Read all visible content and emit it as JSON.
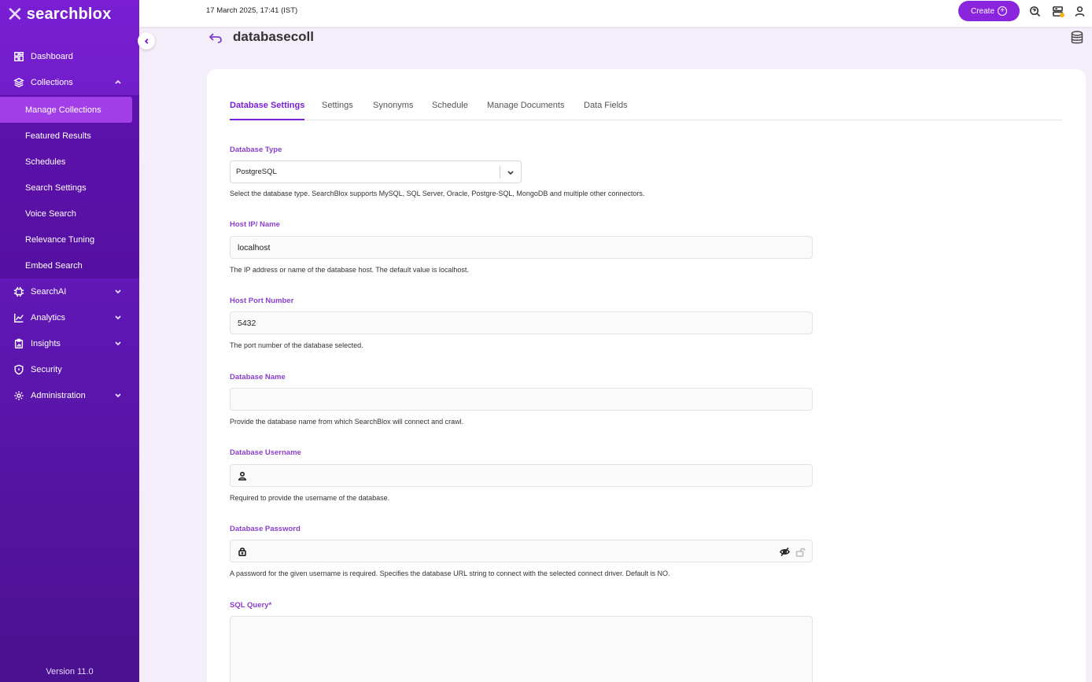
{
  "brand": {
    "mark": "✕",
    "name": "searchblox"
  },
  "sidebar": {
    "items": [
      {
        "label": "Dashboard",
        "icon": "dashboard-icon"
      },
      {
        "label": "Collections",
        "icon": "layers-icon",
        "expanded": true,
        "children": [
          {
            "label": "Manage Collections",
            "active": true
          },
          {
            "label": "Featured Results"
          },
          {
            "label": "Schedules"
          },
          {
            "label": "Search Settings"
          },
          {
            "label": "Voice Search"
          },
          {
            "label": "Relevance Tuning"
          },
          {
            "label": "Embed Search"
          }
        ]
      },
      {
        "label": "SearchAI",
        "icon": "chip-icon"
      },
      {
        "label": "Analytics",
        "icon": "chart-icon"
      },
      {
        "label": "Insights",
        "icon": "clipboard-icon"
      },
      {
        "label": "Security",
        "icon": "shield-icon"
      },
      {
        "label": "Administration",
        "icon": "gear-icon"
      }
    ],
    "version": "Version 11.0"
  },
  "topbar": {
    "date": "17 March 2025, 17:41 (IST)",
    "create_label": "Create"
  },
  "page": {
    "title": "databasecoll"
  },
  "tabs": [
    "Database Settings",
    "Settings",
    "Synonyms",
    "Schedule",
    "Manage Documents",
    "Data Fields"
  ],
  "form": {
    "db_type": {
      "label": "Database Type",
      "value": "PostgreSQL",
      "help": "Select the database type. SearchBlox supports MySQL, SQL Server, Oracle, Postgre-SQL, MongoDB and multiple other connectors."
    },
    "host": {
      "label": "Host IP/ Name",
      "value": "localhost",
      "help": "The IP address or name of the database host. The default value is localhost."
    },
    "port": {
      "label": "Host Port Number",
      "value": "5432",
      "help": "The port number of the database selected."
    },
    "db_name": {
      "label": "Database Name",
      "value": "",
      "help": "Provide the database name from which SearchBlox will connect and crawl."
    },
    "username": {
      "label": "Database Username",
      "value": "",
      "help": "Required to provide the username of the database."
    },
    "password": {
      "label": "Database Password",
      "value": "",
      "help": "A password for the given username is required. Specifies the database URL string to connect with the selected connect driver. Default is NO."
    },
    "sql": {
      "label": "SQL Query*",
      "value": ""
    }
  },
  "colors": {
    "accent": "#8a24dd",
    "label": "#8a3fc9",
    "sidebar_top": "#7a1fd4",
    "sidebar_bottom": "#4a1190"
  }
}
